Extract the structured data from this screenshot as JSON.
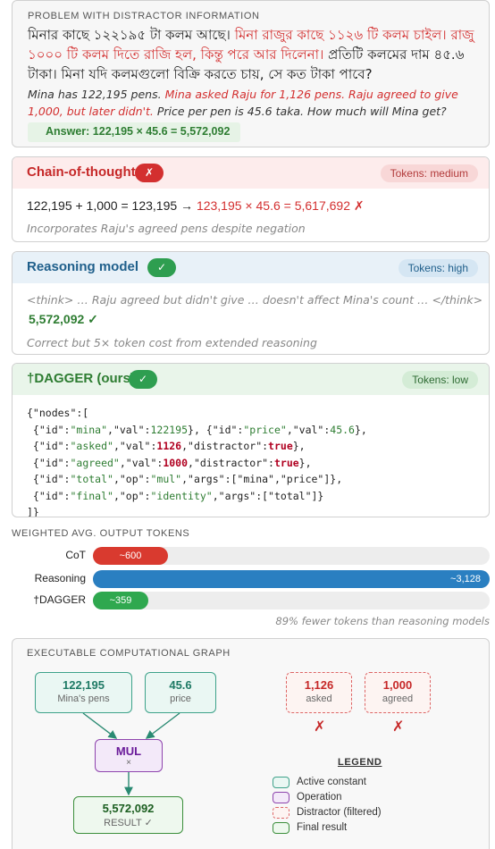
{
  "problem": {
    "label": "PROBLEM WITH DISTRACTOR INFORMATION",
    "bn_part1": "মিনার কাছে ১২২১৯৫ টা কলম আছে। ",
    "bn_distractor": "মিনা রাজুর কাছে ১১২৬ টি কলম চাইল। রাজু ১০০০ টি কলম দিতে রাজি হল, কিন্তু পরে আর দিলেনা। ",
    "bn_part2": " প্রতিটি কলমের দাম ৪৫.৬ টাকা। মিনা যদি কলমগুলো বিক্রি করতে চায়, সে কত টাকা পাবে?",
    "en_part1": "Mina has 122,195 pens. ",
    "en_distractor": "Mina asked Raju for 1,126 pens. Raju agreed to give 1,000, but later didn't.",
    "en_part2": "  Price per pen is 45.6 taka. How much will Mina get?",
    "answer": "Answer: 122,195 × 45.6 = 5,572,092"
  },
  "cot": {
    "title": "Chain-of-thought",
    "badge": "✗",
    "tokens": "Tokens: medium",
    "calc_plain": "122,195 + 1,000 = 123,195 → ",
    "calc_wrong": "123,195 × 45.6 = 5,617,692 ✗",
    "note": "Incorporates Raju's agreed pens despite negation"
  },
  "reasoning": {
    "title": "Reasoning model",
    "badge": "✓",
    "tokens": "Tokens: high",
    "think": "<think> … Raju agreed but didn't give … doesn't affect Mina's count … </think>",
    "value": "5,572,092 ✓",
    "note": "Correct but 5× token cost from extended reasoning"
  },
  "dagger": {
    "title": "†DAGGER (ours)",
    "badge": "✓",
    "tokens": "Tokens: low"
  },
  "bars": {
    "title": "WEIGHTED AVG. OUTPUT TOKENS",
    "note": "89% fewer tokens than reasoning models",
    "items": [
      {
        "label": "CoT",
        "value_label": "~600",
        "fraction": 0.19,
        "color": "#d93a2f"
      },
      {
        "label": "Reasoning",
        "value_label": "~3,128",
        "fraction": 1.0,
        "color": "#2a7fc1"
      },
      {
        "label": "†DAGGER",
        "value_label": "~359",
        "fraction": 0.14,
        "color": "#2fa84f"
      }
    ]
  },
  "graph": {
    "title": "EXECUTABLE COMPUTATIONAL GRAPH",
    "nodes": {
      "mina": {
        "value": "122,195",
        "label": "Mina's pens"
      },
      "price": {
        "value": "45.6",
        "label": "price"
      },
      "asked": {
        "value": "1,126",
        "label": "asked"
      },
      "agreed": {
        "value": "1,000",
        "label": "agreed"
      },
      "mul": {
        "value": "MUL",
        "label": "×"
      },
      "result": {
        "value": "5,572,092",
        "label": "RESULT ✓"
      }
    },
    "x_mark": "✗",
    "legend": {
      "title": "LEGEND",
      "items": [
        "Active constant",
        "Operation",
        "Distractor (filtered)",
        "Final result"
      ]
    }
  }
}
